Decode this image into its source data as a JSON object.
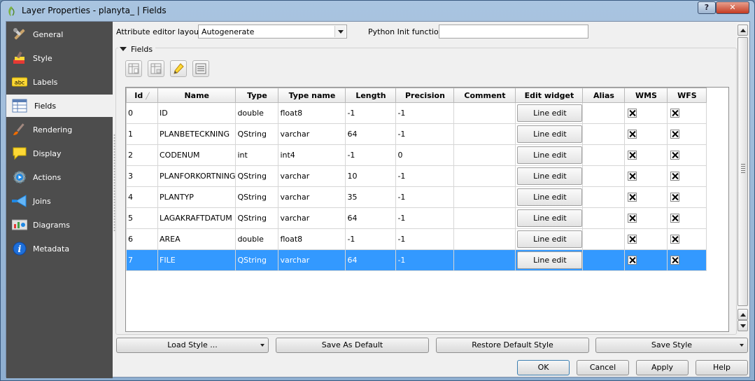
{
  "window": {
    "title": "Layer Properties - planyta_ | Fields",
    "help_label": "?",
    "close_label": "✕"
  },
  "sidebar": {
    "items": [
      {
        "label": "General",
        "icon": "wrench-icon"
      },
      {
        "label": "Style",
        "icon": "paint-brush-icon"
      },
      {
        "label": "Labels",
        "icon": "abc-label-icon"
      },
      {
        "label": "Fields",
        "icon": "table-icon",
        "active": true
      },
      {
        "label": "Rendering",
        "icon": "brush-icon"
      },
      {
        "label": "Display",
        "icon": "speech-bubble-icon"
      },
      {
        "label": "Actions",
        "icon": "gear-play-icon"
      },
      {
        "label": "Joins",
        "icon": "join-arrow-icon"
      },
      {
        "label": "Diagrams",
        "icon": "chart-icon"
      },
      {
        "label": "Metadata",
        "icon": "info-icon"
      }
    ]
  },
  "editor": {
    "layout_label": "Attribute editor layout:",
    "layout_value": "Autogenerate",
    "python_label": "Python Init function",
    "python_value": ""
  },
  "fields_group": {
    "title": "Fields"
  },
  "table": {
    "columns": [
      "Id",
      "Name",
      "Type",
      "Type name",
      "Length",
      "Precision",
      "Comment",
      "Edit widget",
      "Alias",
      "WMS",
      "WFS"
    ],
    "rows": [
      {
        "id": "0",
        "name": "ID",
        "type": "double",
        "type_name": "float8",
        "length": "-1",
        "precision": "-1",
        "comment": "",
        "widget": "Line edit",
        "alias": "",
        "wms": true,
        "wfs": true
      },
      {
        "id": "1",
        "name": "PLANBETECKNING",
        "type": "QString",
        "type_name": "varchar",
        "length": "64",
        "precision": "-1",
        "comment": "",
        "widget": "Line edit",
        "alias": "",
        "wms": true,
        "wfs": true
      },
      {
        "id": "2",
        "name": "CODENUM",
        "type": "int",
        "type_name": "int4",
        "length": "-1",
        "precision": "0",
        "comment": "",
        "widget": "Line edit",
        "alias": "",
        "wms": true,
        "wfs": true
      },
      {
        "id": "3",
        "name": "PLANFORKORTNING",
        "type": "QString",
        "type_name": "varchar",
        "length": "10",
        "precision": "-1",
        "comment": "",
        "widget": "Line edit",
        "alias": "",
        "wms": true,
        "wfs": true
      },
      {
        "id": "4",
        "name": "PLANTYP",
        "type": "QString",
        "type_name": "varchar",
        "length": "35",
        "precision": "-1",
        "comment": "",
        "widget": "Line edit",
        "alias": "",
        "wms": true,
        "wfs": true
      },
      {
        "id": "5",
        "name": "LAGAKRAFTDATUM",
        "type": "QString",
        "type_name": "varchar",
        "length": "64",
        "precision": "-1",
        "comment": "",
        "widget": "Line edit",
        "alias": "",
        "wms": true,
        "wfs": true
      },
      {
        "id": "6",
        "name": "AREA",
        "type": "double",
        "type_name": "float8",
        "length": "-1",
        "precision": "-1",
        "comment": "",
        "widget": "Line edit",
        "alias": "",
        "wms": true,
        "wfs": true
      },
      {
        "id": "7",
        "name": "FILE",
        "type": "QString",
        "type_name": "varchar",
        "length": "64",
        "precision": "-1",
        "comment": "",
        "widget": "Line edit",
        "alias": "",
        "wms": true,
        "wfs": true,
        "selected": true
      }
    ]
  },
  "style_buttons": {
    "load": "Load Style ...",
    "save_default": "Save As Default",
    "restore": "Restore Default Style",
    "save": "Save Style"
  },
  "dialog_buttons": {
    "ok": "OK",
    "cancel": "Cancel",
    "apply": "Apply",
    "help": "Help"
  },
  "colors": {
    "sidebar_bg": "#4d4d4d",
    "selection": "#3399ff",
    "titlebar": "#a9c4e0"
  }
}
